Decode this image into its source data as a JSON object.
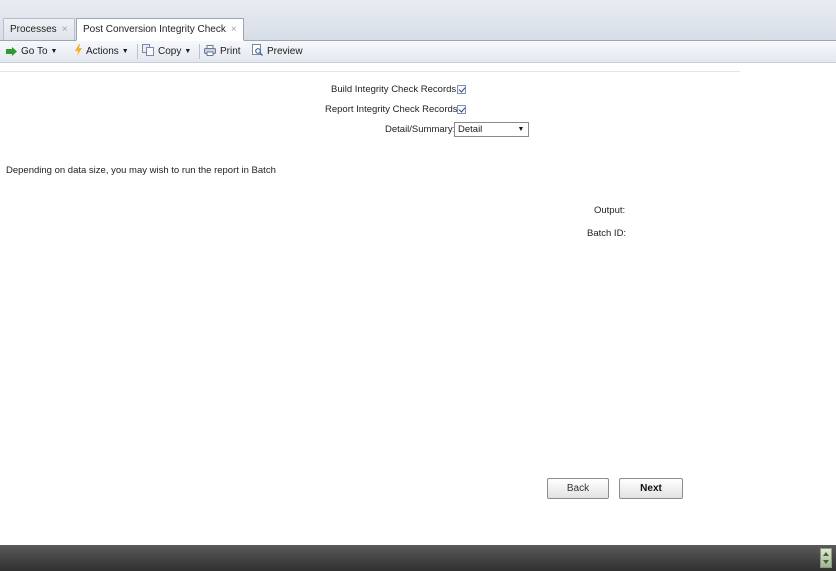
{
  "tabs": [
    {
      "label": "Processes",
      "close": "×"
    },
    {
      "label": "Post Conversion Integrity Check",
      "close": "×"
    }
  ],
  "toolbar": {
    "goto_label": "Go To",
    "actions_label": "Actions",
    "copy_label": "Copy",
    "print_label": "Print",
    "preview_label": "Preview",
    "dropdown_arrow": "▼"
  },
  "form": {
    "build_label": "Build Integrity Check Records:",
    "build_checked": true,
    "report_label": "Report Integrity Check Records:",
    "report_checked": true,
    "detail_label": "Detail/Summary:",
    "detail_value": "Detail",
    "detail_arrow": "▼"
  },
  "note": "Depending on data size, you may wish to run the report in Batch",
  "batch": {
    "output_label": "Output:",
    "batch_id_label": "Batch ID:"
  },
  "buttons": {
    "back": "Back",
    "next": "Next"
  },
  "colors": {
    "toolbar_bg": "#e3e8ef",
    "statusbar_bg": "#303030",
    "checkbox_border": "#7d93b3"
  }
}
